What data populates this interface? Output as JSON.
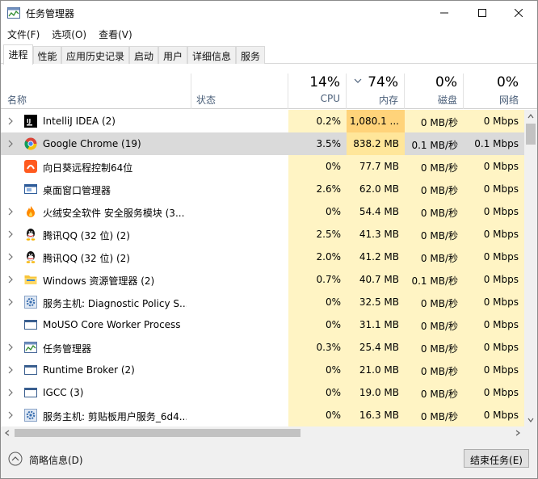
{
  "window": {
    "title": "任务管理器"
  },
  "menu": [
    "文件(F)",
    "选项(O)",
    "查看(V)"
  ],
  "tabs": [
    "进程",
    "性能",
    "应用历史记录",
    "启动",
    "用户",
    "详细信息",
    "服务"
  ],
  "active_tab": "进程",
  "header": {
    "name": "名称",
    "status": "状态",
    "cpu": {
      "pct": "14%",
      "label": "CPU"
    },
    "memory": {
      "pct": "74%",
      "label": "内存"
    },
    "disk": {
      "pct": "0%",
      "label": "磁盘"
    },
    "network": {
      "pct": "0%",
      "label": "网络"
    }
  },
  "colors": {
    "heat_light": "#fff4c4",
    "heat_medium": "#ffe69a",
    "heat_strong": "#ffd37a",
    "selected_row": "#dadada",
    "header_label": "#4c607a"
  },
  "processes": [
    {
      "name": "IntelliJ IDEA (2)",
      "icon": "intellij-icon",
      "expandable": true,
      "cpu": "0.2%",
      "memory": "1,080.1 ...",
      "disk": "0 MB/秒",
      "network": "0 Mbps",
      "mem_heat": "strong"
    },
    {
      "name": "Google Chrome (19)",
      "icon": "chrome-icon",
      "expandable": true,
      "cpu": "3.5%",
      "memory": "838.2 MB",
      "disk": "0.1 MB/秒",
      "network": "0.1 Mbps",
      "mem_heat": "medium",
      "selected": true
    },
    {
      "name": "向日葵远程控制64位",
      "icon": "sunflower-icon",
      "expandable": false,
      "cpu": "0%",
      "memory": "77.7 MB",
      "disk": "0 MB/秒",
      "network": "0 Mbps"
    },
    {
      "name": "桌面窗口管理器",
      "icon": "window-manager-icon",
      "expandable": false,
      "cpu": "2.6%",
      "memory": "62.0 MB",
      "disk": "0 MB/秒",
      "network": "0 Mbps"
    },
    {
      "name": "火绒安全软件 安全服务模块 (3...",
      "icon": "huorong-icon",
      "expandable": true,
      "cpu": "0%",
      "memory": "54.4 MB",
      "disk": "0 MB/秒",
      "network": "0 Mbps"
    },
    {
      "name": "腾讯QQ (32 位) (2)",
      "icon": "qq-icon",
      "expandable": true,
      "cpu": "2.5%",
      "memory": "41.3 MB",
      "disk": "0 MB/秒",
      "network": "0 Mbps"
    },
    {
      "name": "腾讯QQ (32 位) (2)",
      "icon": "qq-icon",
      "expandable": true,
      "cpu": "2.0%",
      "memory": "41.2 MB",
      "disk": "0 MB/秒",
      "network": "0 Mbps"
    },
    {
      "name": "Windows 资源管理器 (2)",
      "icon": "explorer-folder-icon",
      "expandable": true,
      "cpu": "0.7%",
      "memory": "40.7 MB",
      "disk": "0.1 MB/秒",
      "network": "0 Mbps"
    },
    {
      "name": "服务主机: Diagnostic Policy S...",
      "icon": "gear-service-icon",
      "expandable": true,
      "cpu": "0%",
      "memory": "32.5 MB",
      "disk": "0 MB/秒",
      "network": "0 Mbps"
    },
    {
      "name": "MoUSO Core Worker Process",
      "icon": "app-window-icon",
      "expandable": false,
      "cpu": "0%",
      "memory": "31.1 MB",
      "disk": "0 MB/秒",
      "network": "0 Mbps"
    },
    {
      "name": "任务管理器",
      "icon": "task-manager-icon",
      "expandable": true,
      "cpu": "0.3%",
      "memory": "25.4 MB",
      "disk": "0 MB/秒",
      "network": "0 Mbps"
    },
    {
      "name": "Runtime Broker (2)",
      "icon": "app-window-icon",
      "expandable": true,
      "cpu": "0%",
      "memory": "21.0 MB",
      "disk": "0 MB/秒",
      "network": "0 Mbps"
    },
    {
      "name": "IGCC (3)",
      "icon": "app-window-icon",
      "expandable": true,
      "cpu": "0%",
      "memory": "19.0 MB",
      "disk": "0 MB/秒",
      "network": "0 Mbps"
    },
    {
      "name": "服务主机: 剪贴板用户服务_6d4...",
      "icon": "gear-service-icon",
      "expandable": true,
      "cpu": "0%",
      "memory": "16.3 MB",
      "disk": "0 MB/秒",
      "network": "0 Mbps"
    }
  ],
  "footer": {
    "fewer_details": "简略信息(D)",
    "end_task": "结束任务(E)"
  }
}
